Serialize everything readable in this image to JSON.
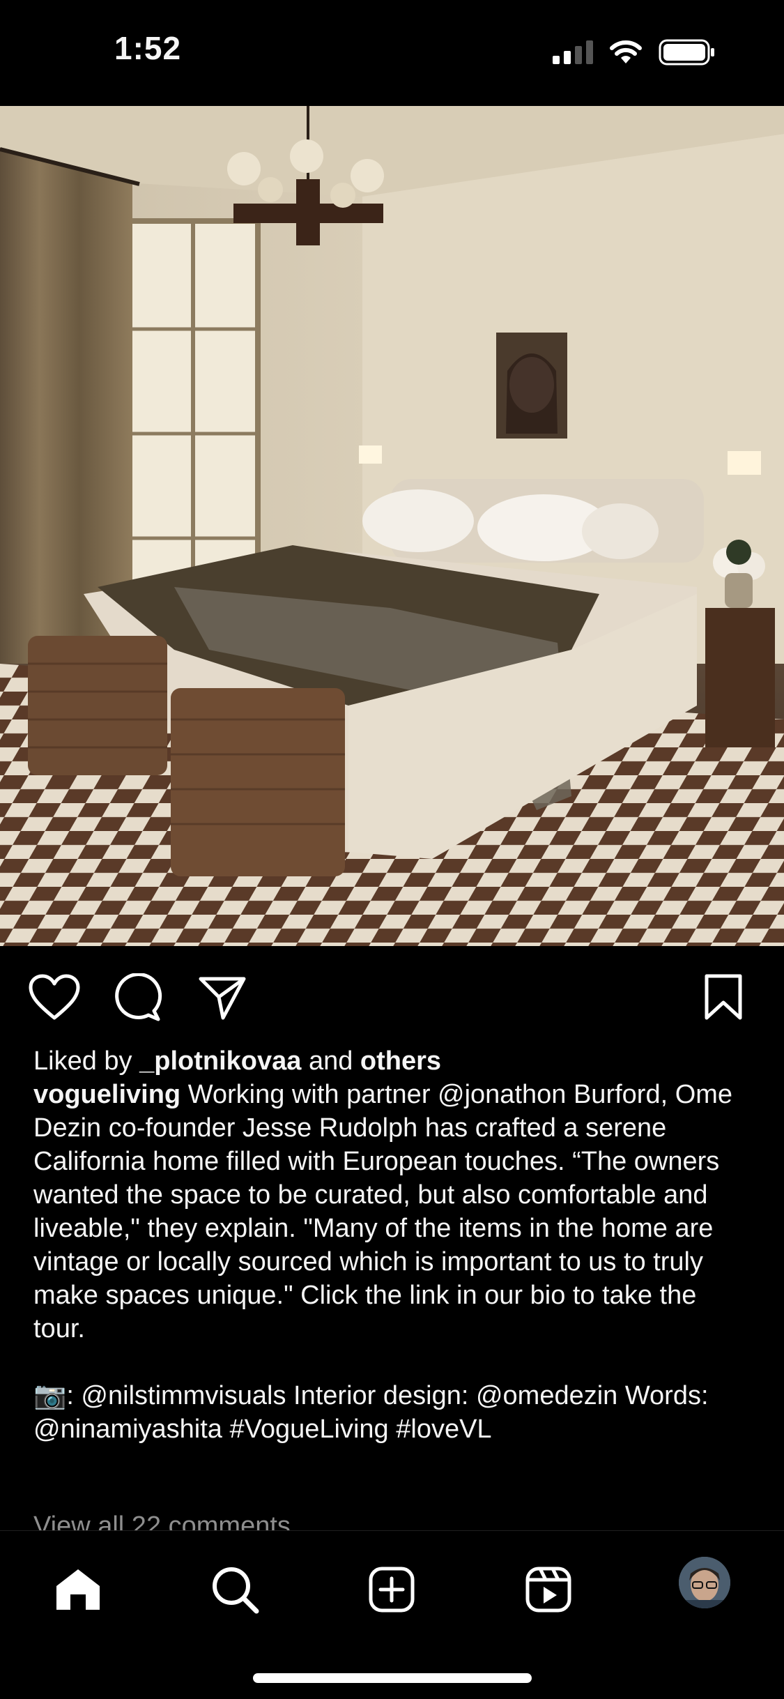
{
  "status_bar": {
    "time": "1:52"
  },
  "post": {
    "image_subject": "bedroom interior photo",
    "likes": {
      "prefix": "Liked by ",
      "user": "_plotnikovaa",
      "middle": " and ",
      "others": "others"
    },
    "caption": {
      "username": "vogueliving",
      "text": " Working with partner @jonathon Burford, Ome Dezin co-founder Jesse Rudolph has crafted a serene California home filled with European touches. “The owners wanted the space to be curated, but also comfortable and liveable,\" they explain. \"Many of the items in the home are vintage or locally sourced which is important to us to truly make spaces unique.\" Click the link in our bio to take the tour.",
      "credits": "📷: @nilstimmvisuals Interior design: @omedezin Words: @ninamiyashita #VogueLiving #loveVL"
    },
    "comments_link": "View all 22 comments"
  },
  "actions": {
    "icons": [
      "heart-icon",
      "comment-icon",
      "share-icon",
      "bookmark-icon"
    ]
  },
  "bottom_nav": {
    "items": [
      "home-icon",
      "search-icon",
      "create-icon",
      "reels-icon",
      "profile-avatar"
    ]
  },
  "colors": {
    "background": "#000000",
    "text": "#f5f5f5",
    "muted": "#8e8e8e"
  }
}
